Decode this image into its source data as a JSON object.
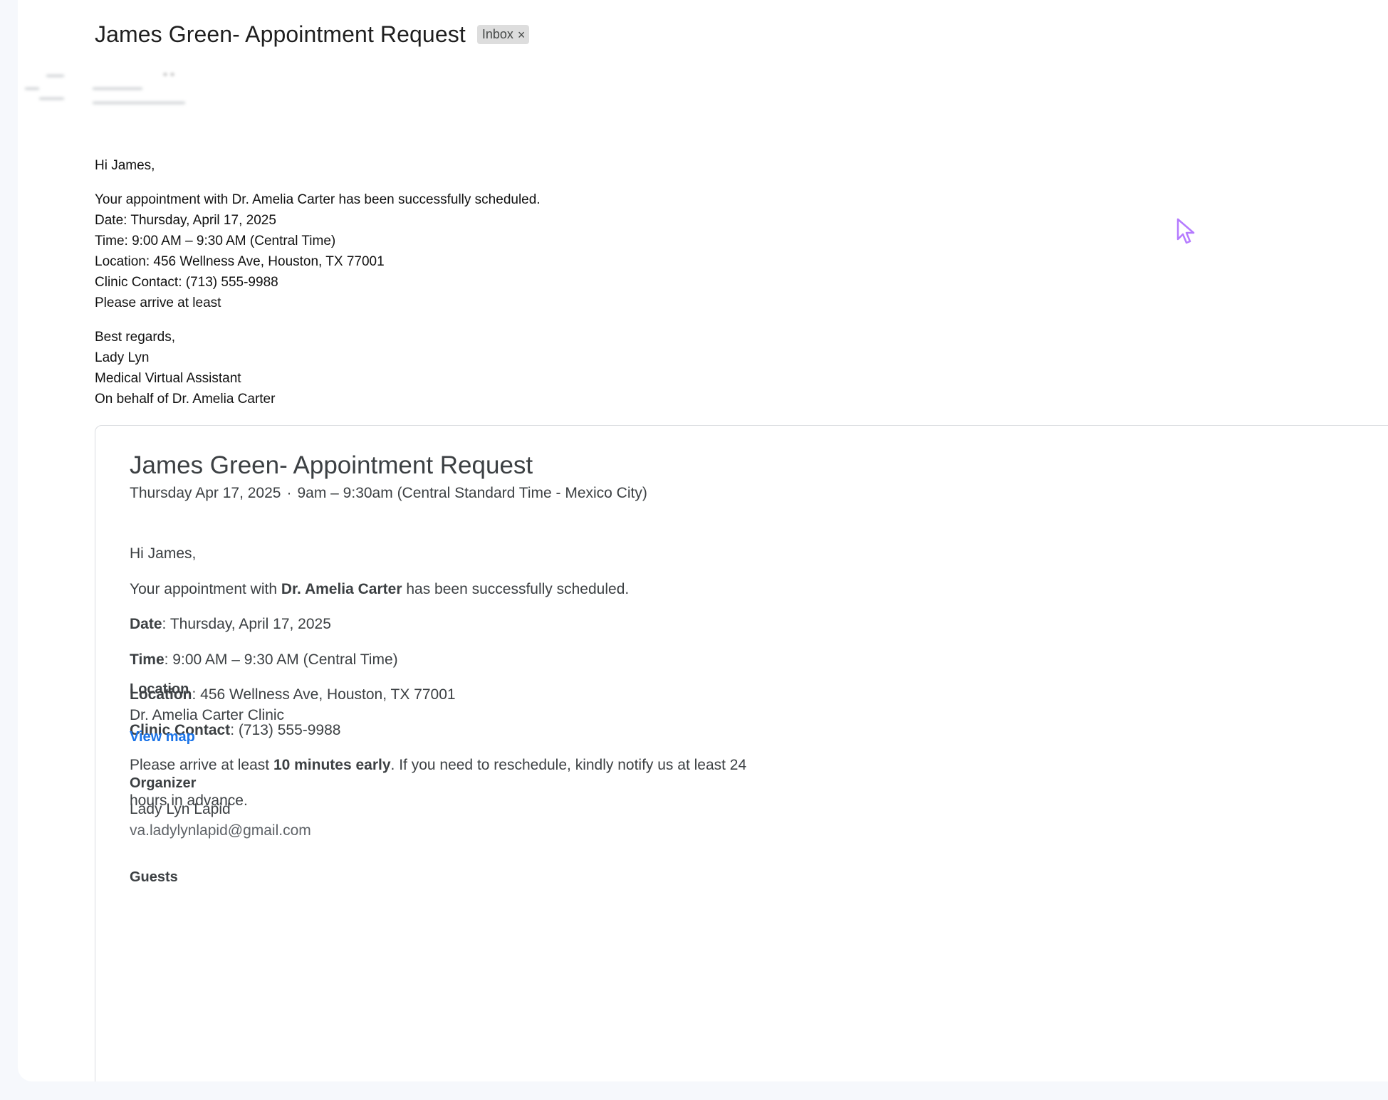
{
  "email": {
    "subject": "James Green- Appointment Request",
    "label": "Inbox",
    "label_close_glyph": "×",
    "body": {
      "greeting": "Hi James,",
      "lines": [
        "Your appointment with Dr. Amelia Carter has been successfully scheduled.",
        "Date: Thursday, April 17, 2025",
        "Time: 9:00 AM – 9:30 AM (Central Time)",
        "Location: 456 Wellness Ave, Houston, TX 77001",
        "Clinic Contact: (713) 555-9988",
        "Please arrive at least"
      ],
      "signature": [
        "Best regards,",
        "Lady Lyn",
        "Medical Virtual Assistant",
        "On behalf of Dr. Amelia Carter"
      ]
    }
  },
  "invite": {
    "title": "James Green- Appointment Request",
    "date": "Thursday Apr 17, 2025",
    "separator": "·",
    "time": "9am – 9:30am (Central Standard Time - Mexico City)",
    "description": {
      "greeting": "Hi James,",
      "scheduled_pre": "Your appointment with ",
      "doctor": "Dr. Amelia Carter",
      "scheduled_post": " has been successfully scheduled.",
      "date_label": "Date",
      "date_value": ": Thursday, April 17, 2025",
      "time_label": "Time",
      "time_value": ": 9:00 AM – 9:30 AM (Central Time)",
      "location_label": "Location",
      "location_value": ": 456 Wellness Ave, Houston, TX 77001",
      "contact_label": "Clinic Contact",
      "contact_value": ": (713) 555-9988",
      "arrive_pre": "Please arrive at least ",
      "arrive_bold": "10 minutes early",
      "arrive_post": ". If you need to reschedule, kindly notify us at least 24",
      "arrive_cont": "hours in advance."
    },
    "location": {
      "heading": "Location",
      "name": "Dr. Amelia Carter Clinic",
      "map_link": "View map"
    },
    "organizer": {
      "heading": "Organizer",
      "name": "Lady Lyn Lapid",
      "email": "va.ladylynlapid@gmail.com"
    },
    "guests": {
      "heading": "Guests"
    }
  },
  "colors": {
    "link": "#1a73e8",
    "cursor": "#b57bff"
  }
}
